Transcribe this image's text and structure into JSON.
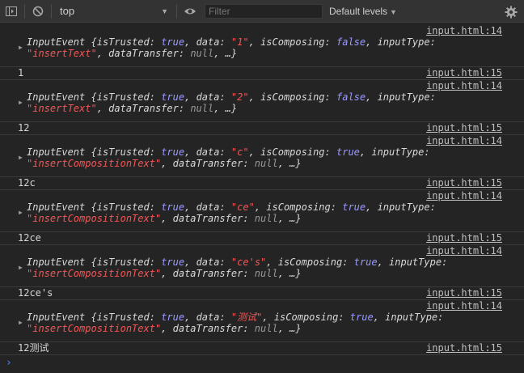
{
  "toolbar": {
    "context": "top",
    "filter_placeholder": "Filter",
    "levels": "Default levels"
  },
  "messages": [
    {
      "source": "input.html:14",
      "line1": [
        {
          "c": "k",
          "t": "InputEvent "
        },
        {
          "c": "p",
          "t": "{"
        },
        {
          "c": "k",
          "t": "isTrusted"
        },
        {
          "c": "p",
          "t": ": "
        },
        {
          "c": "b",
          "t": "true"
        },
        {
          "c": "p",
          "t": ", "
        },
        {
          "c": "k",
          "t": "data"
        },
        {
          "c": "p",
          "t": ": "
        },
        {
          "c": "str",
          "t": "\"1\""
        },
        {
          "c": "p",
          "t": ", "
        },
        {
          "c": "k",
          "t": "isComposing"
        },
        {
          "c": "p",
          "t": ": "
        },
        {
          "c": "b",
          "t": "false"
        },
        {
          "c": "p",
          "t": ", "
        },
        {
          "c": "k",
          "t": "inputType"
        },
        {
          "c": "p",
          "t": ":"
        }
      ],
      "line2": [
        {
          "c": "str",
          "t": "\"insertText\""
        },
        {
          "c": "p",
          "t": ", "
        },
        {
          "c": "k",
          "t": "dataTransfer"
        },
        {
          "c": "p",
          "t": ": "
        },
        {
          "c": "n",
          "t": "null"
        },
        {
          "c": "p",
          "t": ", …}"
        }
      ]
    },
    {
      "value": "1",
      "source": "input.html:15"
    },
    {
      "source": "input.html:14",
      "line1": [
        {
          "c": "k",
          "t": "InputEvent "
        },
        {
          "c": "p",
          "t": "{"
        },
        {
          "c": "k",
          "t": "isTrusted"
        },
        {
          "c": "p",
          "t": ": "
        },
        {
          "c": "b",
          "t": "true"
        },
        {
          "c": "p",
          "t": ", "
        },
        {
          "c": "k",
          "t": "data"
        },
        {
          "c": "p",
          "t": ": "
        },
        {
          "c": "str",
          "t": "\"2\""
        },
        {
          "c": "p",
          "t": ", "
        },
        {
          "c": "k",
          "t": "isComposing"
        },
        {
          "c": "p",
          "t": ": "
        },
        {
          "c": "b",
          "t": "false"
        },
        {
          "c": "p",
          "t": ", "
        },
        {
          "c": "k",
          "t": "inputType"
        },
        {
          "c": "p",
          "t": ":"
        }
      ],
      "line2": [
        {
          "c": "str",
          "t": "\"insertText\""
        },
        {
          "c": "p",
          "t": ", "
        },
        {
          "c": "k",
          "t": "dataTransfer"
        },
        {
          "c": "p",
          "t": ": "
        },
        {
          "c": "n",
          "t": "null"
        },
        {
          "c": "p",
          "t": ", …}"
        }
      ]
    },
    {
      "value": "12",
      "source": "input.html:15"
    },
    {
      "source": "input.html:14",
      "line1": [
        {
          "c": "k",
          "t": "InputEvent "
        },
        {
          "c": "p",
          "t": "{"
        },
        {
          "c": "k",
          "t": "isTrusted"
        },
        {
          "c": "p",
          "t": ": "
        },
        {
          "c": "b",
          "t": "true"
        },
        {
          "c": "p",
          "t": ", "
        },
        {
          "c": "k",
          "t": "data"
        },
        {
          "c": "p",
          "t": ": "
        },
        {
          "c": "str",
          "t": "\"c\""
        },
        {
          "c": "p",
          "t": ", "
        },
        {
          "c": "k",
          "t": "isComposing"
        },
        {
          "c": "p",
          "t": ": "
        },
        {
          "c": "b",
          "t": "true"
        },
        {
          "c": "p",
          "t": ", "
        },
        {
          "c": "k",
          "t": "inputType"
        },
        {
          "c": "p",
          "t": ":"
        }
      ],
      "line2": [
        {
          "c": "str",
          "t": "\"insertCompositionText\""
        },
        {
          "c": "p",
          "t": ", "
        },
        {
          "c": "k",
          "t": "dataTransfer"
        },
        {
          "c": "p",
          "t": ": "
        },
        {
          "c": "n",
          "t": "null"
        },
        {
          "c": "p",
          "t": ", …}"
        }
      ]
    },
    {
      "value": "12c",
      "source": "input.html:15"
    },
    {
      "source": "input.html:14",
      "line1": [
        {
          "c": "k",
          "t": "InputEvent "
        },
        {
          "c": "p",
          "t": "{"
        },
        {
          "c": "k",
          "t": "isTrusted"
        },
        {
          "c": "p",
          "t": ": "
        },
        {
          "c": "b",
          "t": "true"
        },
        {
          "c": "p",
          "t": ", "
        },
        {
          "c": "k",
          "t": "data"
        },
        {
          "c": "p",
          "t": ": "
        },
        {
          "c": "str",
          "t": "\"ce\""
        },
        {
          "c": "p",
          "t": ", "
        },
        {
          "c": "k",
          "t": "isComposing"
        },
        {
          "c": "p",
          "t": ": "
        },
        {
          "c": "b",
          "t": "true"
        },
        {
          "c": "p",
          "t": ", "
        },
        {
          "c": "k",
          "t": "inputType"
        },
        {
          "c": "p",
          "t": ":"
        }
      ],
      "line2": [
        {
          "c": "str",
          "t": "\"insertCompositionText\""
        },
        {
          "c": "p",
          "t": ", "
        },
        {
          "c": "k",
          "t": "dataTransfer"
        },
        {
          "c": "p",
          "t": ": "
        },
        {
          "c": "n",
          "t": "null"
        },
        {
          "c": "p",
          "t": ", …}"
        }
      ]
    },
    {
      "value": "12ce",
      "source": "input.html:15"
    },
    {
      "source": "input.html:14",
      "line1": [
        {
          "c": "k",
          "t": "InputEvent "
        },
        {
          "c": "p",
          "t": "{"
        },
        {
          "c": "k",
          "t": "isTrusted"
        },
        {
          "c": "p",
          "t": ": "
        },
        {
          "c": "b",
          "t": "true"
        },
        {
          "c": "p",
          "t": ", "
        },
        {
          "c": "k",
          "t": "data"
        },
        {
          "c": "p",
          "t": ": "
        },
        {
          "c": "str",
          "t": "\"ce's\""
        },
        {
          "c": "p",
          "t": ", "
        },
        {
          "c": "k",
          "t": "isComposing"
        },
        {
          "c": "p",
          "t": ": "
        },
        {
          "c": "b",
          "t": "true"
        },
        {
          "c": "p",
          "t": ", "
        },
        {
          "c": "k",
          "t": "inputType"
        },
        {
          "c": "p",
          "t": ":"
        }
      ],
      "line2": [
        {
          "c": "str",
          "t": "\"insertCompositionText\""
        },
        {
          "c": "p",
          "t": ", "
        },
        {
          "c": "k",
          "t": "dataTransfer"
        },
        {
          "c": "p",
          "t": ": "
        },
        {
          "c": "n",
          "t": "null"
        },
        {
          "c": "p",
          "t": ", …}"
        }
      ]
    },
    {
      "value": "12ce's",
      "source": "input.html:15"
    },
    {
      "source": "input.html:14",
      "line1": [
        {
          "c": "k",
          "t": "InputEvent "
        },
        {
          "c": "p",
          "t": "{"
        },
        {
          "c": "k",
          "t": "isTrusted"
        },
        {
          "c": "p",
          "t": ": "
        },
        {
          "c": "b",
          "t": "true"
        },
        {
          "c": "p",
          "t": ", "
        },
        {
          "c": "k",
          "t": "data"
        },
        {
          "c": "p",
          "t": ": "
        },
        {
          "c": "str",
          "t": "\"测试\""
        },
        {
          "c": "p",
          "t": ", "
        },
        {
          "c": "k",
          "t": "isComposing"
        },
        {
          "c": "p",
          "t": ": "
        },
        {
          "c": "b",
          "t": "true"
        },
        {
          "c": "p",
          "t": ", "
        },
        {
          "c": "k",
          "t": "inputType"
        },
        {
          "c": "p",
          "t": ":"
        }
      ],
      "line2": [
        {
          "c": "str",
          "t": "\"insertCompositionText\""
        },
        {
          "c": "p",
          "t": ", "
        },
        {
          "c": "k",
          "t": "dataTransfer"
        },
        {
          "c": "p",
          "t": ": "
        },
        {
          "c": "n",
          "t": "null"
        },
        {
          "c": "p",
          "t": ", …}"
        }
      ]
    },
    {
      "value": "12测试",
      "source": "input.html:15"
    }
  ],
  "icons": {
    "toggle_sidebar": "sidebar-toggle-icon",
    "clear": "clear-console-icon",
    "eye": "eye-icon",
    "gear": "gear-icon",
    "prompt": "chevron-right-icon"
  },
  "colors": {
    "background": "#242424",
    "toolbar": "#333333",
    "boolean": "#9b9bff",
    "string": "#f25757",
    "prompt": "#3b8cff"
  }
}
